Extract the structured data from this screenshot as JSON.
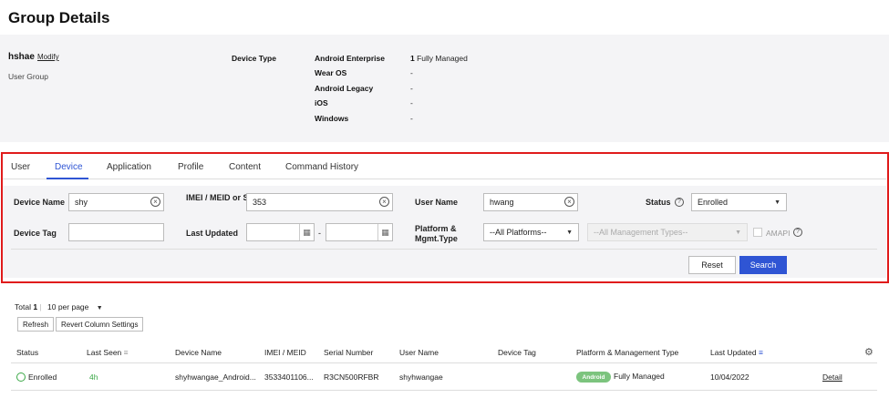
{
  "page": {
    "title": "Group Details"
  },
  "group": {
    "name": "hshae",
    "modify_label": "Modify",
    "type": "User Group",
    "device_type_label": "Device Type",
    "device_types": [
      {
        "name": "Android Enterprise",
        "count": "1",
        "mode": "Fully Managed"
      },
      {
        "name": "Wear OS",
        "value": "-"
      },
      {
        "name": "Android Legacy",
        "value": "-"
      },
      {
        "name": "iOS",
        "value": "-"
      },
      {
        "name": "Windows",
        "value": "-"
      }
    ]
  },
  "tabs": [
    "User",
    "Device",
    "Application",
    "Profile",
    "Content",
    "Command History"
  ],
  "active_tab": "Device",
  "filters": {
    "device_name": {
      "label": "Device Name",
      "value": "shy"
    },
    "imei": {
      "label": "IMEI / MEID or Serial Number",
      "value": "353"
    },
    "user_name": {
      "label": "User Name",
      "value": "hwang"
    },
    "status": {
      "label": "Status",
      "value": "Enrolled"
    },
    "device_tag": {
      "label": "Device Tag",
      "value": ""
    },
    "last_updated": {
      "label": "Last Updated",
      "from": "",
      "to": "",
      "sep": "-"
    },
    "platform": {
      "label": "Platform & Mgmt.Type",
      "value": "--All Platforms--",
      "mgmt_value": "--All Management Types--"
    },
    "amapi_label": "AMAPI",
    "reset_label": "Reset",
    "search_label": "Search"
  },
  "results": {
    "total_label": "Total",
    "total_count": "1",
    "separator": "|",
    "per_page": "10 per page",
    "refresh_label": "Refresh",
    "revert_label": "Revert Column Settings",
    "columns": [
      "Status",
      "Last Seen",
      "Device Name",
      "IMEI / MEID",
      "Serial Number",
      "User Name",
      "Device Tag",
      "Platform & Management Type",
      "Last Updated"
    ],
    "rows": [
      {
        "status": "Enrolled",
        "last_seen": "4h",
        "device_name": "shyhwangae_Android...",
        "imei": "3533401106...",
        "serial": "R3CN500RFBR",
        "user_name": "shyhwangae",
        "device_tag": "",
        "platform_badge": "Android",
        "mgmt": "Fully Managed",
        "last_updated": "10/04/2022",
        "detail_label": "Detail"
      }
    ]
  },
  "colors": {
    "accent": "#2f55d4",
    "frame": "#e01b1b",
    "enrolled": "#3aa846",
    "android_badge": "#7cc47e"
  }
}
